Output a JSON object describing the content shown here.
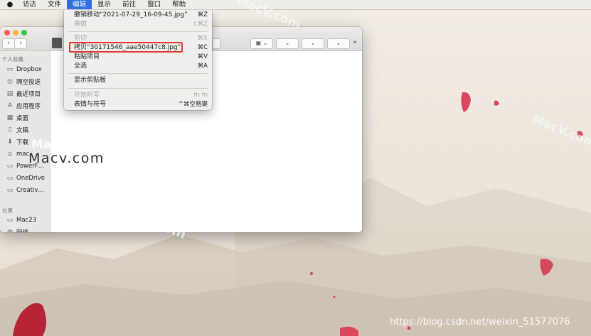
{
  "menubar": {
    "apple_icon": "apple-logo-icon",
    "items": [
      "访达",
      "文件",
      "编辑",
      "显示",
      "前往",
      "窗口",
      "帮助"
    ],
    "active_index": 2
  },
  "edit_menu": {
    "items": [
      {
        "label": "撤销移动“2021-07-29_16-09-45.jpg”",
        "shortcut": "⌘Z",
        "enabled": true
      },
      {
        "label": "重做",
        "shortcut": "⇧⌘Z",
        "enabled": false
      },
      {
        "label": "剪切",
        "shortcut": "⌘X",
        "enabled": false
      },
      {
        "label": "拷贝“30171546_aae50447c8.jpg”",
        "shortcut": "⌘C",
        "enabled": true,
        "highlighted": true
      },
      {
        "label": "粘贴项目",
        "shortcut": "⌘V",
        "enabled": true
      },
      {
        "label": "全选",
        "shortcut": "⌘A",
        "enabled": true
      },
      {
        "label": "显示剪贴板",
        "shortcut": "",
        "enabled": true
      },
      {
        "label": "开始听写",
        "shortcut": "fn fn",
        "enabled": false
      },
      {
        "label": "表情与符号",
        "shortcut": "^⌘空格键",
        "enabled": true
      }
    ],
    "highlight_color": "#dd3b34"
  },
  "finder": {
    "nav_back": "‹",
    "nav_forward": "›",
    "selected_fragment": "30",
    "sidebar": {
      "favorites_title": "个人收藏",
      "favorites": [
        {
          "label": "Dropbox",
          "icon": "folder-icon"
        },
        {
          "label": "隔空投送",
          "icon": "airdrop-icon"
        },
        {
          "label": "最近项目",
          "icon": "recents-icon"
        },
        {
          "label": "应用程序",
          "icon": "applications-icon"
        },
        {
          "label": "桌面",
          "icon": "desktop-icon"
        },
        {
          "label": "文稿",
          "icon": "documents-icon"
        },
        {
          "label": "下载",
          "icon": "downloads-icon"
        },
        {
          "label": "mac",
          "icon": "home-icon"
        },
        {
          "label": "PowerF…",
          "icon": "folder-icon"
        },
        {
          "label": "OneDrive",
          "icon": "folder-icon"
        },
        {
          "label": "Creativ…",
          "icon": "folder-icon"
        }
      ],
      "locations_title": "位置",
      "locations": [
        {
          "label": "Mac23",
          "icon": "computer-icon"
        },
        {
          "label": "网络",
          "icon": "network-icon"
        }
      ]
    }
  },
  "watermarks": {
    "macv": "Macv.com",
    "macv_partial": "Ma",
    "diagonal": "MacV.com",
    "url": "https://blog.csdn.net/weixin_51577076"
  }
}
